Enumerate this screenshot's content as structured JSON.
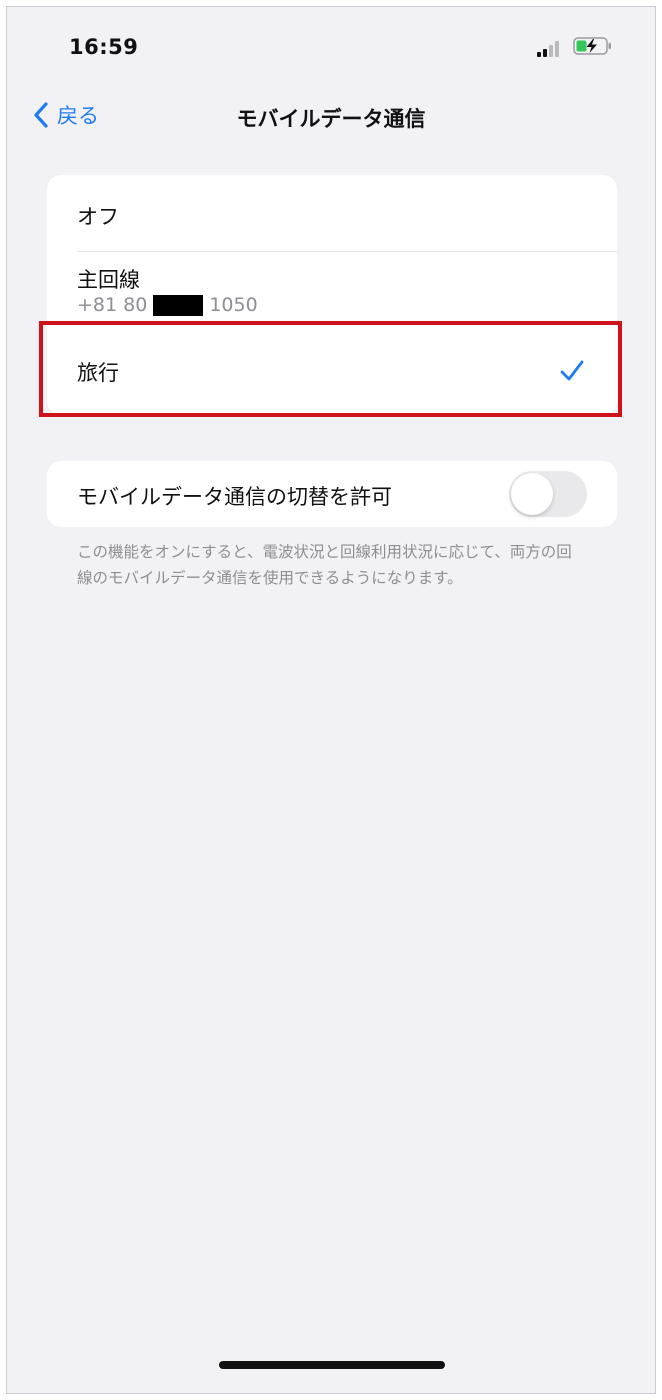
{
  "status_bar": {
    "time": "16:59"
  },
  "nav": {
    "back_label": "戻る",
    "title": "モバイルデータ通信"
  },
  "line_options": {
    "items": [
      {
        "label": "オフ"
      },
      {
        "label": "主回線",
        "number_prefix": "+81 80",
        "number_suffix": "1050"
      },
      {
        "label": "旅行",
        "selected": true
      }
    ]
  },
  "switching": {
    "label": "モバイルデータ通信の切替を許可",
    "enabled": false,
    "footnote": "この機能をオンにすると、電波状況と回線利用状況に応じて、両方の回線のモバイルデータ通信を使用できるようになります。"
  },
  "colors": {
    "accent": "#1e7cf2",
    "highlight": "#d0121b",
    "background": "#f2f1f6"
  }
}
